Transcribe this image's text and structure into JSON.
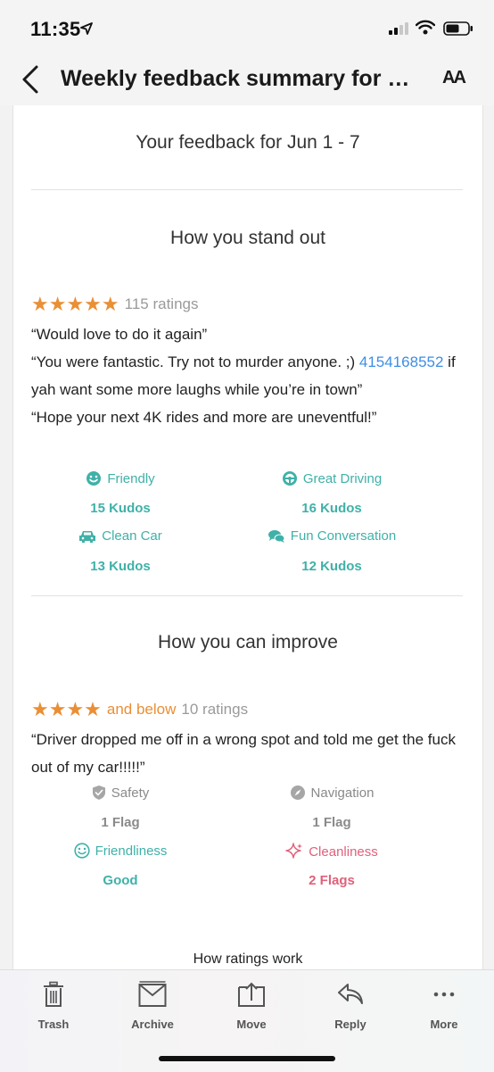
{
  "status_bar": {
    "time": "11:35"
  },
  "nav": {
    "title": "Weekly feedback summary for Jun...",
    "text_size_label": "AA"
  },
  "email": {
    "header": "Your feedback for Jun 1 - 7",
    "stand_out": {
      "heading": "How you stand out",
      "stars": "★★★★★",
      "ratings": "115 ratings",
      "comments": [
        "“Would love to do it again”",
        "“You were fantastic. Try not to murder anyone. ;) ",
        "4154168552",
        " if yah want some more laughs while you’re in town”",
        "“Hope your next 4K rides and more are uneventful!”"
      ],
      "kudos": [
        {
          "label": "Friendly",
          "count": "15 Kudos",
          "icon": "smiley-icon"
        },
        {
          "label": "Great Driving",
          "count": "16 Kudos",
          "icon": "steering-wheel-icon"
        },
        {
          "label": "Clean Car",
          "count": "13 Kudos",
          "icon": "car-icon"
        },
        {
          "label": "Fun Conversation",
          "count": "12 Kudos",
          "icon": "chat-bubbles-icon"
        }
      ]
    },
    "improve": {
      "heading": "How you can improve",
      "stars": "★★★★",
      "and_below": "and below",
      "ratings": "10 ratings",
      "comment": "“Driver dropped me off in a wrong spot and told me get the fuck out of my car!!!!!”",
      "flags": [
        {
          "label": "Safety",
          "count": "1 Flag",
          "icon": "shield-icon"
        },
        {
          "label": "Navigation",
          "count": "1 Flag",
          "icon": "compass-icon"
        },
        {
          "label": "Friendliness",
          "count": "Good",
          "icon": "smiley-icon"
        },
        {
          "label": "Cleanliness",
          "count": "2 Flags",
          "icon": "sparkle-icon"
        }
      ]
    },
    "how_ratings_work": "How ratings work"
  },
  "toolbar": {
    "trash": "Trash",
    "archive": "Archive",
    "move": "Move",
    "reply": "Reply",
    "more": "More"
  },
  "colors": {
    "teal": "#3fb1a8",
    "orange": "#e98f35",
    "link": "#3d8ee6",
    "red": "#e0607a",
    "gray": "#8a8a8a"
  }
}
